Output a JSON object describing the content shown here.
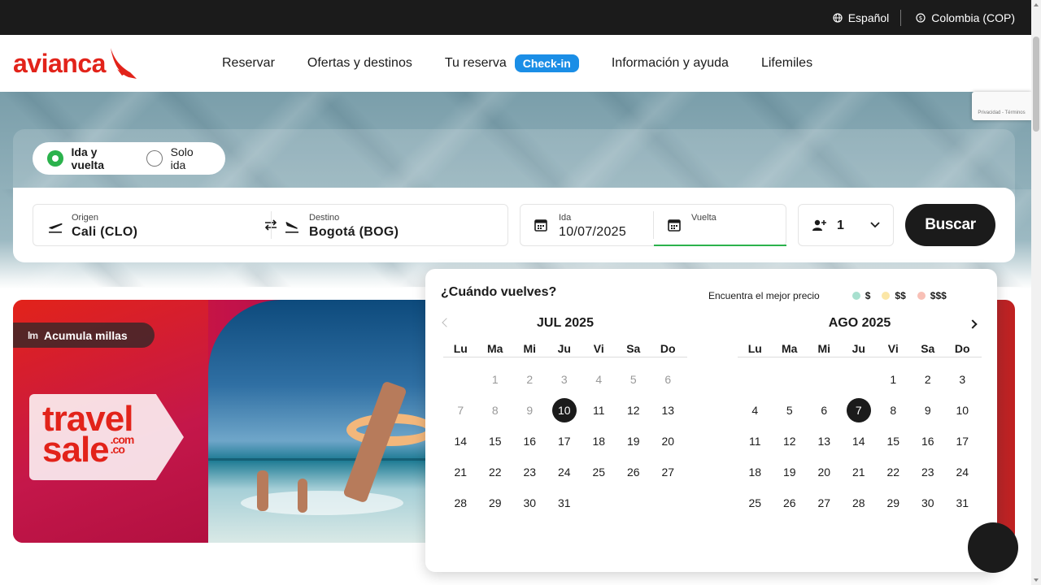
{
  "topbar": {
    "language": "Español",
    "region": "Colombia (COP)"
  },
  "header": {
    "logo_text": "avianca",
    "nav": [
      {
        "label": "Reservar"
      },
      {
        "label": "Ofertas y destinos"
      },
      {
        "label": "Tu reserva",
        "badge": "Check-in"
      },
      {
        "label": "Información y ayuda"
      },
      {
        "label": "Lifemiles"
      }
    ]
  },
  "booking": {
    "trip_types": [
      {
        "label": "Ida y vuelta",
        "selected": true
      },
      {
        "label": "Solo ida",
        "selected": false
      }
    ],
    "origin": {
      "label": "Origen",
      "value": "Cali  (CLO)"
    },
    "destination": {
      "label": "Destino",
      "value": "Bogotá  (BOG)"
    },
    "depart": {
      "label": "Ida",
      "value": "10/07/2025"
    },
    "return": {
      "label": "Vuelta",
      "value": ""
    },
    "passengers": "1",
    "search_label": "Buscar"
  },
  "promo": {
    "badge": "Acumula millas",
    "badge_icon": "lm",
    "tag_line1": "travel",
    "tag_line2": "sale",
    "tag_suffix1": ".com",
    "tag_suffix2": ".co"
  },
  "recaptcha": "Privacidad - Términos",
  "calendar": {
    "title": "¿Cuándo vuelves?",
    "legend_label": "Encuentra el mejor precio",
    "legend": [
      {
        "label": "$",
        "color": "#a8e0cf"
      },
      {
        "label": "$$",
        "color": "#fbe6a6"
      },
      {
        "label": "$$$",
        "color": "#f8c0b6"
      }
    ],
    "weekdays": [
      "Lu",
      "Ma",
      "Mi",
      "Ju",
      "Vi",
      "Sa",
      "Do"
    ],
    "months": [
      {
        "name": "JUL 2025",
        "offset": 1,
        "days": 31,
        "muted_until": 9,
        "selected": 10
      },
      {
        "name": "AGO 2025",
        "offset": 4,
        "days": 31,
        "muted_until": 0,
        "selected": 7
      }
    ]
  },
  "colors": {
    "brand_red": "#e2231a",
    "checkin_blue": "#1b8ee6",
    "selected_green": "#2bb24c",
    "dark": "#1b1b1b"
  }
}
